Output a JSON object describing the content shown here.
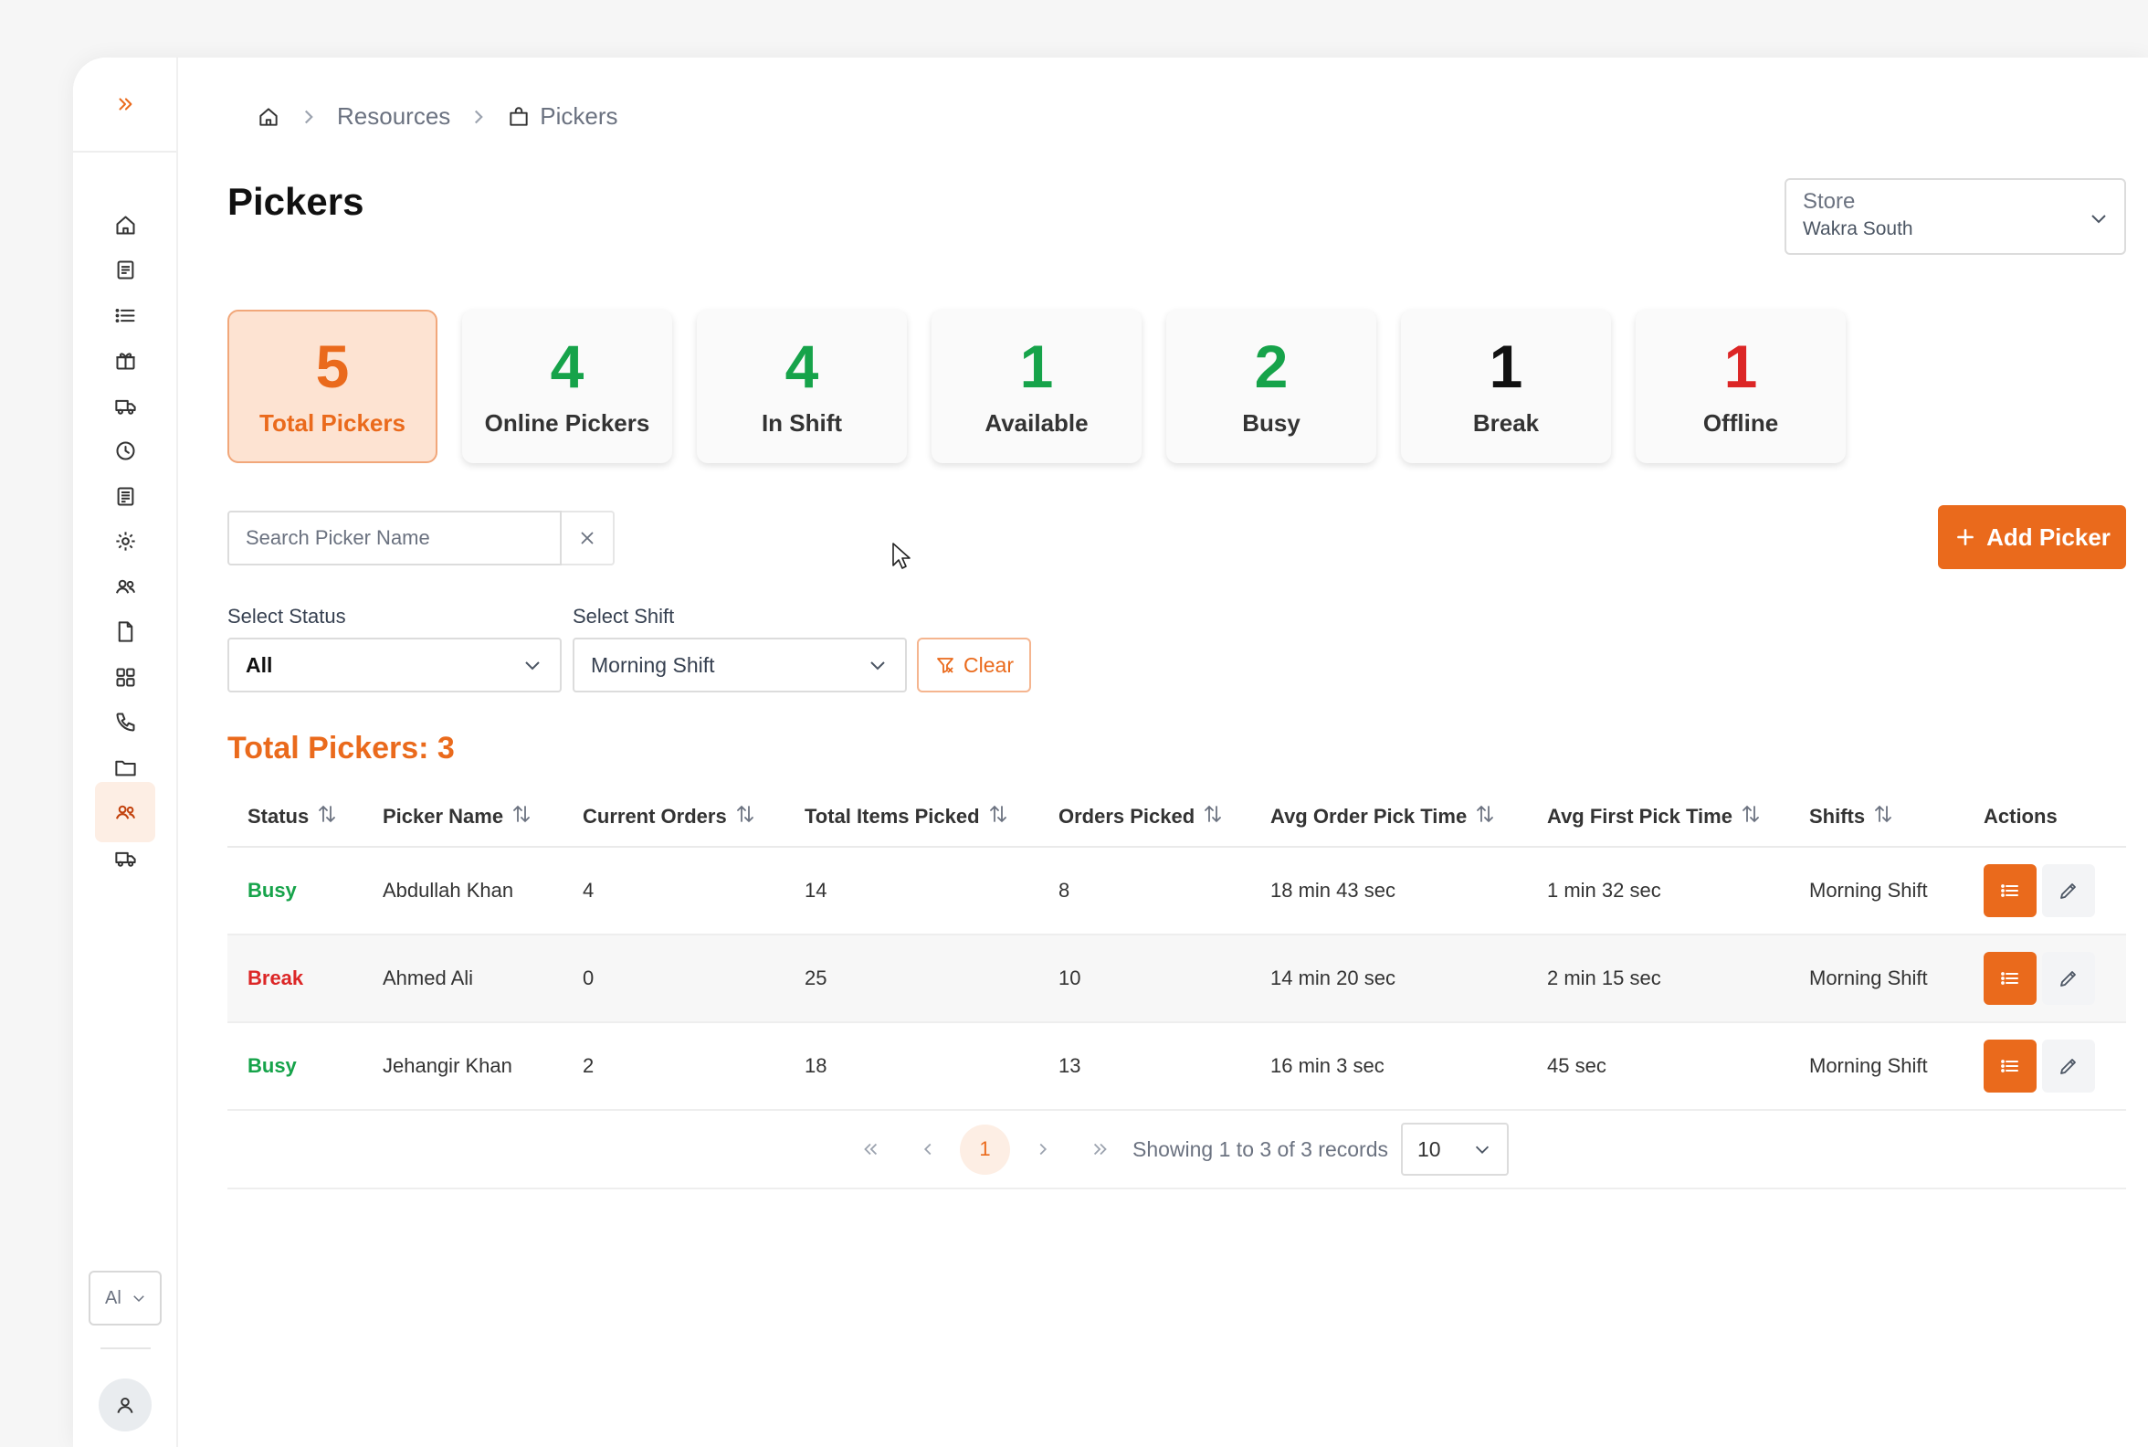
{
  "sidebar": {
    "toggle_icon": "double-chevron-right-icon",
    "items": [
      {
        "icon": "home-icon"
      },
      {
        "icon": "document-icon"
      },
      {
        "icon": "list-icon"
      },
      {
        "icon": "gift-icon"
      },
      {
        "icon": "delivery-truck-icon"
      },
      {
        "icon": "clock-icon"
      },
      {
        "icon": "receipt-icon"
      },
      {
        "icon": "gear-icon"
      },
      {
        "icon": "users-icon"
      },
      {
        "icon": "file-icon"
      },
      {
        "icon": "grid-icon"
      },
      {
        "icon": "phone-icon"
      },
      {
        "icon": "folder-icon"
      },
      {
        "icon": "pickers-icon",
        "active": true
      },
      {
        "icon": "delivery-truck-icon"
      }
    ],
    "language": "Al",
    "avatar_icon": "user-icon"
  },
  "breadcrumb": {
    "home_icon": "home-icon",
    "items": [
      "Resources",
      "Pickers"
    ]
  },
  "page_title": "Pickers",
  "store": {
    "label": "Store",
    "value": "Wakra South"
  },
  "stat_cards": [
    {
      "value": "5",
      "label": "Total Pickers",
      "color": "#ea6a1c",
      "active": true
    },
    {
      "value": "4",
      "label": "Online Pickers",
      "color": "#16a34a"
    },
    {
      "value": "4",
      "label": "In Shift",
      "color": "#16a34a"
    },
    {
      "value": "1",
      "label": "Available",
      "color": "#16a34a"
    },
    {
      "value": "2",
      "label": "Busy",
      "color": "#16a34a"
    },
    {
      "value": "1",
      "label": "Break",
      "color": "#111111"
    },
    {
      "value": "1",
      "label": "Offline",
      "color": "#dc2626"
    }
  ],
  "search": {
    "placeholder": "Search Picker Name",
    "value": ""
  },
  "add_button": "Add Picker",
  "filters": {
    "status_label": "Select Status",
    "status_value": "All",
    "shift_label": "Select Shift",
    "shift_value": "Morning Shift",
    "clear_label": "Clear"
  },
  "total_title": "Total Pickers: 3",
  "table": {
    "headers": [
      "Status",
      "Picker Name",
      "Current Orders",
      "Total Items Picked",
      "Orders Picked",
      "Avg Order Pick Time",
      "Avg First Pick Time",
      "Shifts",
      "Actions"
    ],
    "rows": [
      {
        "status": "Busy",
        "name": "Abdullah Khan",
        "current_orders": "4",
        "total_items": "14",
        "orders_picked": "8",
        "avg_order_time": "18 min 43 sec",
        "avg_first_time": "1 min 32 sec",
        "shift": "Morning Shift"
      },
      {
        "status": "Break",
        "name": "Ahmed Ali",
        "current_orders": "0",
        "total_items": "25",
        "orders_picked": "10",
        "avg_order_time": "14 min 20 sec",
        "avg_first_time": "2 min 15 sec",
        "shift": "Morning Shift"
      },
      {
        "status": "Busy",
        "name": "Jehangir Khan",
        "current_orders": "2",
        "total_items": "18",
        "orders_picked": "13",
        "avg_order_time": "16 min 3 sec",
        "avg_first_time": "45 sec",
        "shift": "Morning Shift"
      }
    ]
  },
  "pagination": {
    "current_page": "1",
    "summary": "Showing 1 to 3 of 3 records",
    "page_size": "10"
  },
  "colors": {
    "accent": "#ea6a1c",
    "busy": "#16a34a",
    "break": "#dc2626"
  }
}
